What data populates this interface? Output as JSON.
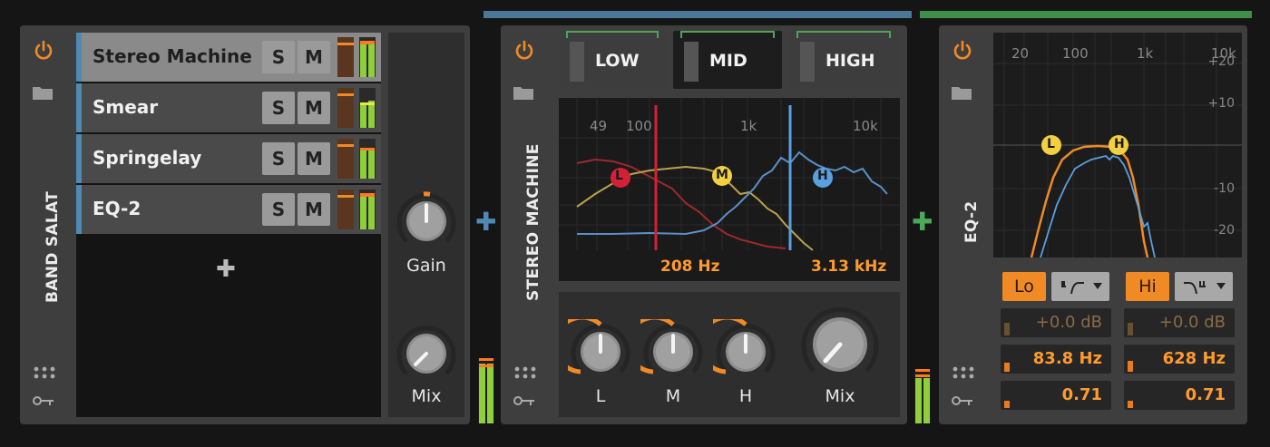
{
  "colors": {
    "orange": "#f08a24",
    "chain_blue": "#4f8ab4",
    "bracket_blue": "#4b7896",
    "bracket_green": "#3f8f4a",
    "plus_green": "#4ca85a",
    "meter_green": "#8fcf3c"
  },
  "band_salat": {
    "title": "BAND SALAT",
    "chains": [
      {
        "name": "Stereo Machine",
        "solo": "S",
        "mute": "M",
        "selected": true
      },
      {
        "name": "Smear",
        "solo": "S",
        "mute": "M",
        "selected": false
      },
      {
        "name": "Springelay",
        "solo": "S",
        "mute": "M",
        "selected": false
      },
      {
        "name": "EQ-2",
        "solo": "S",
        "mute": "M",
        "selected": false
      }
    ],
    "add_chain": "✚",
    "gain_label": "Gain",
    "mix_label": "Mix"
  },
  "stereo_machine": {
    "title": "STEREO MACHINE",
    "bands": [
      {
        "label": "LOW",
        "active": false
      },
      {
        "label": "MID",
        "active": true
      },
      {
        "label": "HIGH",
        "active": false
      }
    ],
    "freq_ticks": [
      "49",
      "100",
      "1k",
      "10k"
    ],
    "crossover_low": "208 Hz",
    "crossover_high": "3.13 kHz",
    "markers": {
      "low": "L",
      "mid": "M",
      "high": "H"
    },
    "knobs": [
      "L",
      "M",
      "H"
    ],
    "mix_label": "Mix"
  },
  "eq2": {
    "title": "EQ-2",
    "freq_ticks": [
      "20",
      "100",
      "1k",
      "10k"
    ],
    "db_ticks": [
      "+20",
      "+10",
      "-10",
      "-20"
    ],
    "markers": {
      "low": "L",
      "high": "H"
    },
    "lo": {
      "label": "Lo",
      "filter_icon": "highpass-icon",
      "gain": "+0.0 dB",
      "freq": "83.8 Hz",
      "q": "0.71"
    },
    "hi": {
      "label": "Hi",
      "filter_icon": "lowpass-icon",
      "gain": "+0.0 dB",
      "freq": "628 Hz",
      "q": "0.71"
    }
  },
  "separators": {
    "add_fx": "✚"
  }
}
